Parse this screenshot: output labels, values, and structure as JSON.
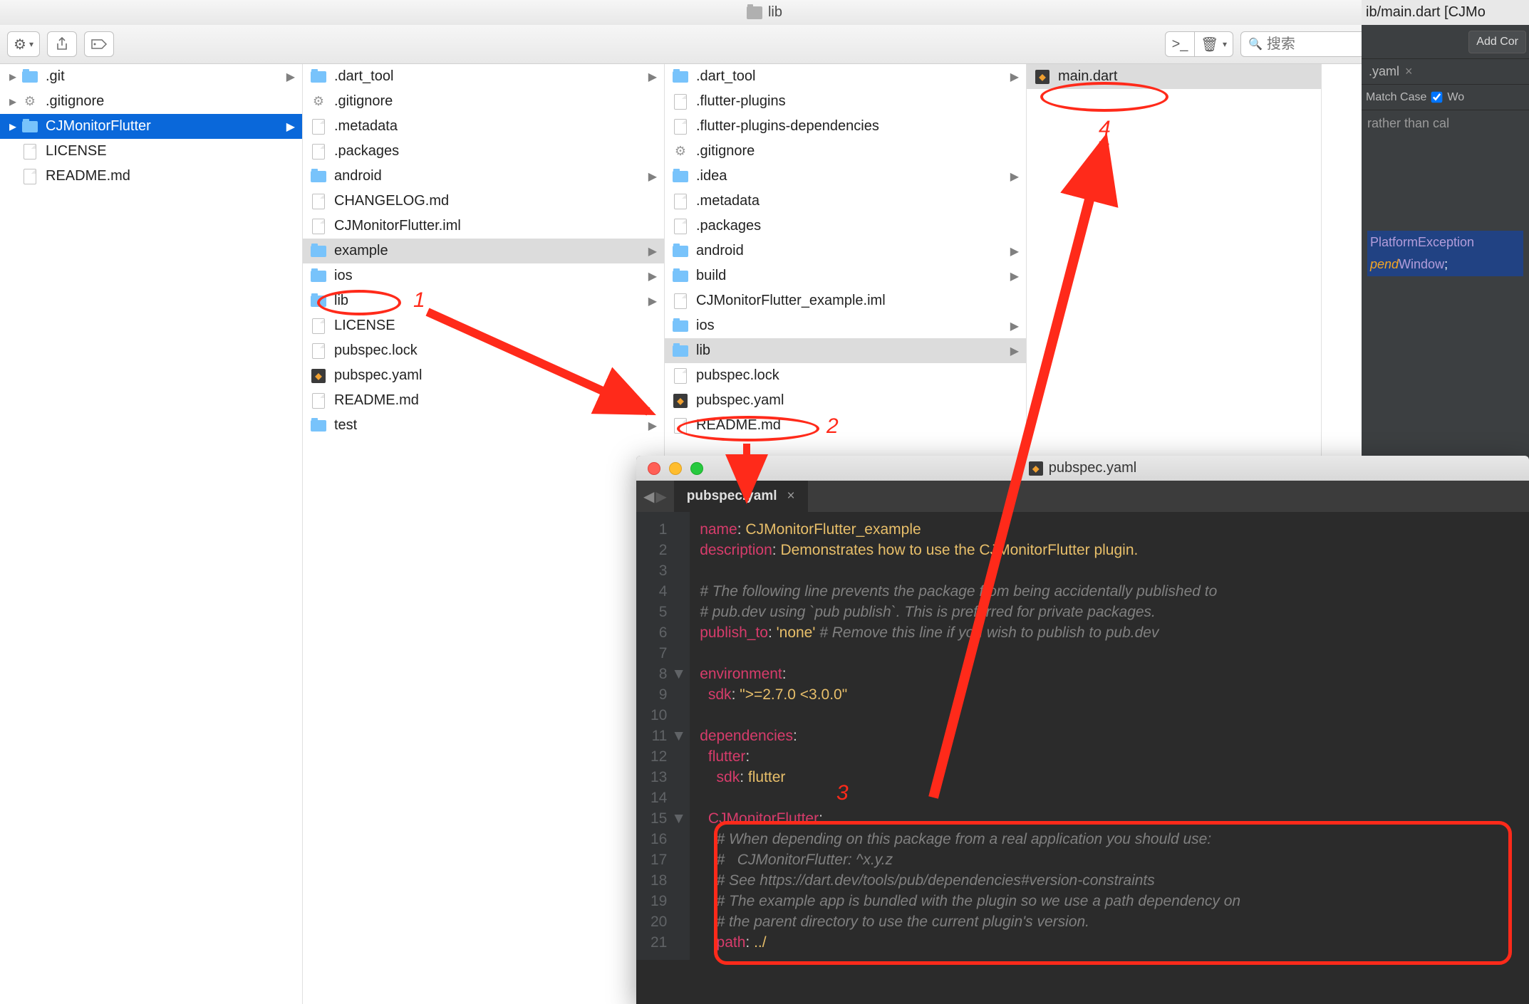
{
  "finder": {
    "title": "lib",
    "search_placeholder": "搜索",
    "col1": [
      {
        "type": "folder",
        "label": ".git",
        "disclosure": true,
        "chev": true
      },
      {
        "type": "gear",
        "label": ".gitignore",
        "disclosure": true
      },
      {
        "type": "folder",
        "label": "CJMonitorFlutter",
        "disclosure": true,
        "chev": true,
        "selected": "blue"
      },
      {
        "type": "file",
        "label": "LICENSE"
      },
      {
        "type": "file",
        "label": "README.md"
      }
    ],
    "col2": [
      {
        "type": "folder",
        "label": ".dart_tool",
        "chev": true
      },
      {
        "type": "gear",
        "label": ".gitignore"
      },
      {
        "type": "file",
        "label": ".metadata"
      },
      {
        "type": "file",
        "label": ".packages"
      },
      {
        "type": "folder",
        "label": "android",
        "chev": true
      },
      {
        "type": "file",
        "label": "CHANGELOG.md"
      },
      {
        "type": "file",
        "label": "CJMonitorFlutter.iml"
      },
      {
        "type": "folder",
        "label": "example",
        "chev": true,
        "selected": "grey"
      },
      {
        "type": "folder",
        "label": "ios",
        "chev": true
      },
      {
        "type": "folder",
        "label": "lib",
        "chev": true
      },
      {
        "type": "file",
        "label": "LICENSE"
      },
      {
        "type": "file",
        "label": "pubspec.lock"
      },
      {
        "type": "dart",
        "label": "pubspec.yaml"
      },
      {
        "type": "file",
        "label": "README.md"
      },
      {
        "type": "folder",
        "label": "test",
        "chev": true
      }
    ],
    "col3": [
      {
        "type": "folder",
        "label": ".dart_tool",
        "chev": true
      },
      {
        "type": "file",
        "label": ".flutter-plugins"
      },
      {
        "type": "file",
        "label": ".flutter-plugins-dependencies"
      },
      {
        "type": "gear",
        "label": ".gitignore"
      },
      {
        "type": "folder",
        "label": ".idea",
        "chev": true
      },
      {
        "type": "file",
        "label": ".metadata"
      },
      {
        "type": "file",
        "label": ".packages"
      },
      {
        "type": "folder",
        "label": "android",
        "chev": true
      },
      {
        "type": "folder",
        "label": "build",
        "chev": true
      },
      {
        "type": "file",
        "label": "CJMonitorFlutter_example.iml"
      },
      {
        "type": "folder",
        "label": "ios",
        "chev": true
      },
      {
        "type": "folder",
        "label": "lib",
        "chev": true,
        "selected": "grey"
      },
      {
        "type": "file",
        "label": "pubspec.lock"
      },
      {
        "type": "dart",
        "label": "pubspec.yaml"
      },
      {
        "type": "file",
        "label": "README.md"
      }
    ],
    "col4": [
      {
        "type": "dart",
        "label": "main.dart",
        "selected": "grey"
      }
    ]
  },
  "ide": {
    "titlebar": "ib/main.dart [CJMo",
    "add_config": "Add Cor",
    "tab": ".yaml",
    "match_case": "Match Case",
    "wo": "Wo",
    "code_line": " rather than cal",
    "sel_line1": "PlatformException",
    "sel_line2_a": "pend",
    "sel_line2_b": "Window",
    "sel_line2_c": ";"
  },
  "editor": {
    "title": "pubspec.yaml",
    "tab": "pubspec.yaml",
    "lines": [
      {
        "n": "1",
        "t": [
          [
            "key",
            "name"
          ],
          [
            "p",
            ": "
          ],
          [
            "str",
            "CJMonitorFlutter_example"
          ]
        ]
      },
      {
        "n": "2",
        "t": [
          [
            "key",
            "description"
          ],
          [
            "p",
            ": "
          ],
          [
            "str",
            "Demonstrates how to use the CJMonitorFlutter plugin."
          ]
        ]
      },
      {
        "n": "3",
        "t": []
      },
      {
        "n": "4",
        "t": [
          [
            "cm",
            "# The following line prevents the package from being accidentally published to"
          ]
        ]
      },
      {
        "n": "5",
        "t": [
          [
            "cm",
            "# pub.dev using `pub publish`. This is preferred for private packages."
          ]
        ]
      },
      {
        "n": "6",
        "t": [
          [
            "key",
            "publish_to"
          ],
          [
            "p",
            ": "
          ],
          [
            "str",
            "'none'"
          ],
          [
            "p",
            " "
          ],
          [
            "cm",
            "# Remove this line if you wish to publish to pub.dev"
          ]
        ]
      },
      {
        "n": "7",
        "t": []
      },
      {
        "n": "8",
        "t": [
          [
            "key",
            "environment"
          ],
          [
            "p",
            ":"
          ]
        ],
        "fold": true
      },
      {
        "n": "9",
        "t": [
          [
            "p",
            "  "
          ],
          [
            "key",
            "sdk"
          ],
          [
            "p",
            ": "
          ],
          [
            "str",
            "\">=2.7.0 <3.0.0\""
          ]
        ]
      },
      {
        "n": "10",
        "t": []
      },
      {
        "n": "11",
        "t": [
          [
            "key",
            "dependencies"
          ],
          [
            "p",
            ":"
          ]
        ],
        "fold": true
      },
      {
        "n": "12",
        "t": [
          [
            "p",
            "  "
          ],
          [
            "key",
            "flutter"
          ],
          [
            "p",
            ":"
          ]
        ]
      },
      {
        "n": "13",
        "t": [
          [
            "p",
            "    "
          ],
          [
            "key",
            "sdk"
          ],
          [
            "p",
            ": "
          ],
          [
            "str",
            "flutter"
          ]
        ]
      },
      {
        "n": "14",
        "t": []
      },
      {
        "n": "15",
        "t": [
          [
            "p",
            "  "
          ],
          [
            "key",
            "CJMonitorFlutter"
          ],
          [
            "p",
            ":"
          ]
        ],
        "fold": true
      },
      {
        "n": "16",
        "t": [
          [
            "p",
            "    "
          ],
          [
            "cm",
            "# When depending on this package from a real application you should use:"
          ]
        ]
      },
      {
        "n": "17",
        "t": [
          [
            "p",
            "    "
          ],
          [
            "cm",
            "#   CJMonitorFlutter: ^x.y.z"
          ]
        ]
      },
      {
        "n": "18",
        "t": [
          [
            "p",
            "    "
          ],
          [
            "cm",
            "# See https://dart.dev/tools/pub/dependencies#version-constraints"
          ]
        ]
      },
      {
        "n": "19",
        "t": [
          [
            "p",
            "    "
          ],
          [
            "cm",
            "# The example app is bundled with the plugin so we use a path dependency on"
          ]
        ]
      },
      {
        "n": "20",
        "t": [
          [
            "p",
            "    "
          ],
          [
            "cm",
            "# the parent directory to use the current plugin's version."
          ]
        ]
      },
      {
        "n": "21",
        "t": [
          [
            "p",
            "    "
          ],
          [
            "key",
            "path"
          ],
          [
            "p",
            ": "
          ],
          [
            "str",
            "../"
          ]
        ]
      }
    ]
  },
  "annotations": {
    "n1": "1",
    "n2": "2",
    "n3": "3",
    "n4": "4"
  }
}
